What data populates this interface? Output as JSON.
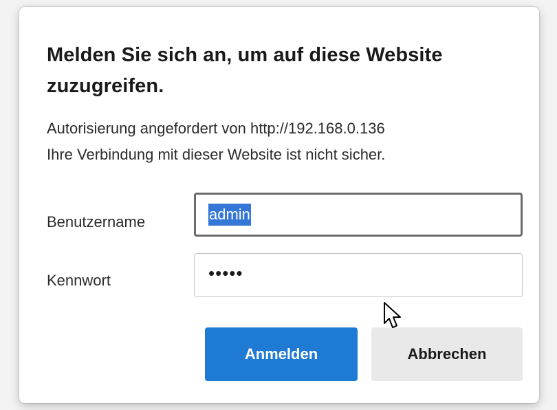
{
  "dialog": {
    "title": "Melden Sie sich an, um auf diese Website zuzugreifen.",
    "auth_line": "Autorisierung angefordert von http://192.168.0.136",
    "warning_line": "Ihre Verbindung mit dieser Website ist nicht sicher.",
    "username_label": "Benutzername",
    "username_value": "admin",
    "password_label": "Kennwort",
    "password_masked": "•••••",
    "login_button": "Anmelden",
    "cancel_button": "Abbrechen"
  },
  "colors": {
    "primary_button": "#1f7ad3",
    "secondary_button": "#e9e9e9",
    "selection": "#3477d6"
  },
  "icons": {
    "cursor": "mouse-pointer-icon"
  }
}
